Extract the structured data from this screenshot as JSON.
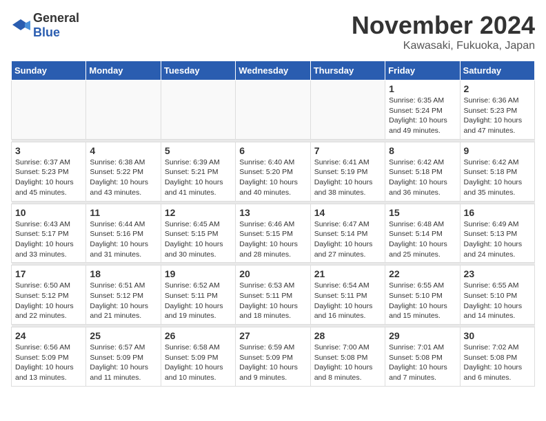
{
  "logo": {
    "general": "General",
    "blue": "Blue"
  },
  "header": {
    "month": "November 2024",
    "location": "Kawasaki, Fukuoka, Japan"
  },
  "weekdays": [
    "Sunday",
    "Monday",
    "Tuesday",
    "Wednesday",
    "Thursday",
    "Friday",
    "Saturday"
  ],
  "weeks": [
    [
      {
        "day": "",
        "empty": true
      },
      {
        "day": "",
        "empty": true
      },
      {
        "day": "",
        "empty": true
      },
      {
        "day": "",
        "empty": true
      },
      {
        "day": "",
        "empty": true
      },
      {
        "day": "1",
        "sunrise": "Sunrise: 6:35 AM",
        "sunset": "Sunset: 5:24 PM",
        "daylight": "Daylight: 10 hours and 49 minutes."
      },
      {
        "day": "2",
        "sunrise": "Sunrise: 6:36 AM",
        "sunset": "Sunset: 5:23 PM",
        "daylight": "Daylight: 10 hours and 47 minutes."
      }
    ],
    [
      {
        "day": "3",
        "sunrise": "Sunrise: 6:37 AM",
        "sunset": "Sunset: 5:23 PM",
        "daylight": "Daylight: 10 hours and 45 minutes."
      },
      {
        "day": "4",
        "sunrise": "Sunrise: 6:38 AM",
        "sunset": "Sunset: 5:22 PM",
        "daylight": "Daylight: 10 hours and 43 minutes."
      },
      {
        "day": "5",
        "sunrise": "Sunrise: 6:39 AM",
        "sunset": "Sunset: 5:21 PM",
        "daylight": "Daylight: 10 hours and 41 minutes."
      },
      {
        "day": "6",
        "sunrise": "Sunrise: 6:40 AM",
        "sunset": "Sunset: 5:20 PM",
        "daylight": "Daylight: 10 hours and 40 minutes."
      },
      {
        "day": "7",
        "sunrise": "Sunrise: 6:41 AM",
        "sunset": "Sunset: 5:19 PM",
        "daylight": "Daylight: 10 hours and 38 minutes."
      },
      {
        "day": "8",
        "sunrise": "Sunrise: 6:42 AM",
        "sunset": "Sunset: 5:18 PM",
        "daylight": "Daylight: 10 hours and 36 minutes."
      },
      {
        "day": "9",
        "sunrise": "Sunrise: 6:42 AM",
        "sunset": "Sunset: 5:18 PM",
        "daylight": "Daylight: 10 hours and 35 minutes."
      }
    ],
    [
      {
        "day": "10",
        "sunrise": "Sunrise: 6:43 AM",
        "sunset": "Sunset: 5:17 PM",
        "daylight": "Daylight: 10 hours and 33 minutes."
      },
      {
        "day": "11",
        "sunrise": "Sunrise: 6:44 AM",
        "sunset": "Sunset: 5:16 PM",
        "daylight": "Daylight: 10 hours and 31 minutes."
      },
      {
        "day": "12",
        "sunrise": "Sunrise: 6:45 AM",
        "sunset": "Sunset: 5:15 PM",
        "daylight": "Daylight: 10 hours and 30 minutes."
      },
      {
        "day": "13",
        "sunrise": "Sunrise: 6:46 AM",
        "sunset": "Sunset: 5:15 PM",
        "daylight": "Daylight: 10 hours and 28 minutes."
      },
      {
        "day": "14",
        "sunrise": "Sunrise: 6:47 AM",
        "sunset": "Sunset: 5:14 PM",
        "daylight": "Daylight: 10 hours and 27 minutes."
      },
      {
        "day": "15",
        "sunrise": "Sunrise: 6:48 AM",
        "sunset": "Sunset: 5:14 PM",
        "daylight": "Daylight: 10 hours and 25 minutes."
      },
      {
        "day": "16",
        "sunrise": "Sunrise: 6:49 AM",
        "sunset": "Sunset: 5:13 PM",
        "daylight": "Daylight: 10 hours and 24 minutes."
      }
    ],
    [
      {
        "day": "17",
        "sunrise": "Sunrise: 6:50 AM",
        "sunset": "Sunset: 5:12 PM",
        "daylight": "Daylight: 10 hours and 22 minutes."
      },
      {
        "day": "18",
        "sunrise": "Sunrise: 6:51 AM",
        "sunset": "Sunset: 5:12 PM",
        "daylight": "Daylight: 10 hours and 21 minutes."
      },
      {
        "day": "19",
        "sunrise": "Sunrise: 6:52 AM",
        "sunset": "Sunset: 5:11 PM",
        "daylight": "Daylight: 10 hours and 19 minutes."
      },
      {
        "day": "20",
        "sunrise": "Sunrise: 6:53 AM",
        "sunset": "Sunset: 5:11 PM",
        "daylight": "Daylight: 10 hours and 18 minutes."
      },
      {
        "day": "21",
        "sunrise": "Sunrise: 6:54 AM",
        "sunset": "Sunset: 5:11 PM",
        "daylight": "Daylight: 10 hours and 16 minutes."
      },
      {
        "day": "22",
        "sunrise": "Sunrise: 6:55 AM",
        "sunset": "Sunset: 5:10 PM",
        "daylight": "Daylight: 10 hours and 15 minutes."
      },
      {
        "day": "23",
        "sunrise": "Sunrise: 6:55 AM",
        "sunset": "Sunset: 5:10 PM",
        "daylight": "Daylight: 10 hours and 14 minutes."
      }
    ],
    [
      {
        "day": "24",
        "sunrise": "Sunrise: 6:56 AM",
        "sunset": "Sunset: 5:09 PM",
        "daylight": "Daylight: 10 hours and 13 minutes."
      },
      {
        "day": "25",
        "sunrise": "Sunrise: 6:57 AM",
        "sunset": "Sunset: 5:09 PM",
        "daylight": "Daylight: 10 hours and 11 minutes."
      },
      {
        "day": "26",
        "sunrise": "Sunrise: 6:58 AM",
        "sunset": "Sunset: 5:09 PM",
        "daylight": "Daylight: 10 hours and 10 minutes."
      },
      {
        "day": "27",
        "sunrise": "Sunrise: 6:59 AM",
        "sunset": "Sunset: 5:09 PM",
        "daylight": "Daylight: 10 hours and 9 minutes."
      },
      {
        "day": "28",
        "sunrise": "Sunrise: 7:00 AM",
        "sunset": "Sunset: 5:08 PM",
        "daylight": "Daylight: 10 hours and 8 minutes."
      },
      {
        "day": "29",
        "sunrise": "Sunrise: 7:01 AM",
        "sunset": "Sunset: 5:08 PM",
        "daylight": "Daylight: 10 hours and 7 minutes."
      },
      {
        "day": "30",
        "sunrise": "Sunrise: 7:02 AM",
        "sunset": "Sunset: 5:08 PM",
        "daylight": "Daylight: 10 hours and 6 minutes."
      }
    ]
  ]
}
